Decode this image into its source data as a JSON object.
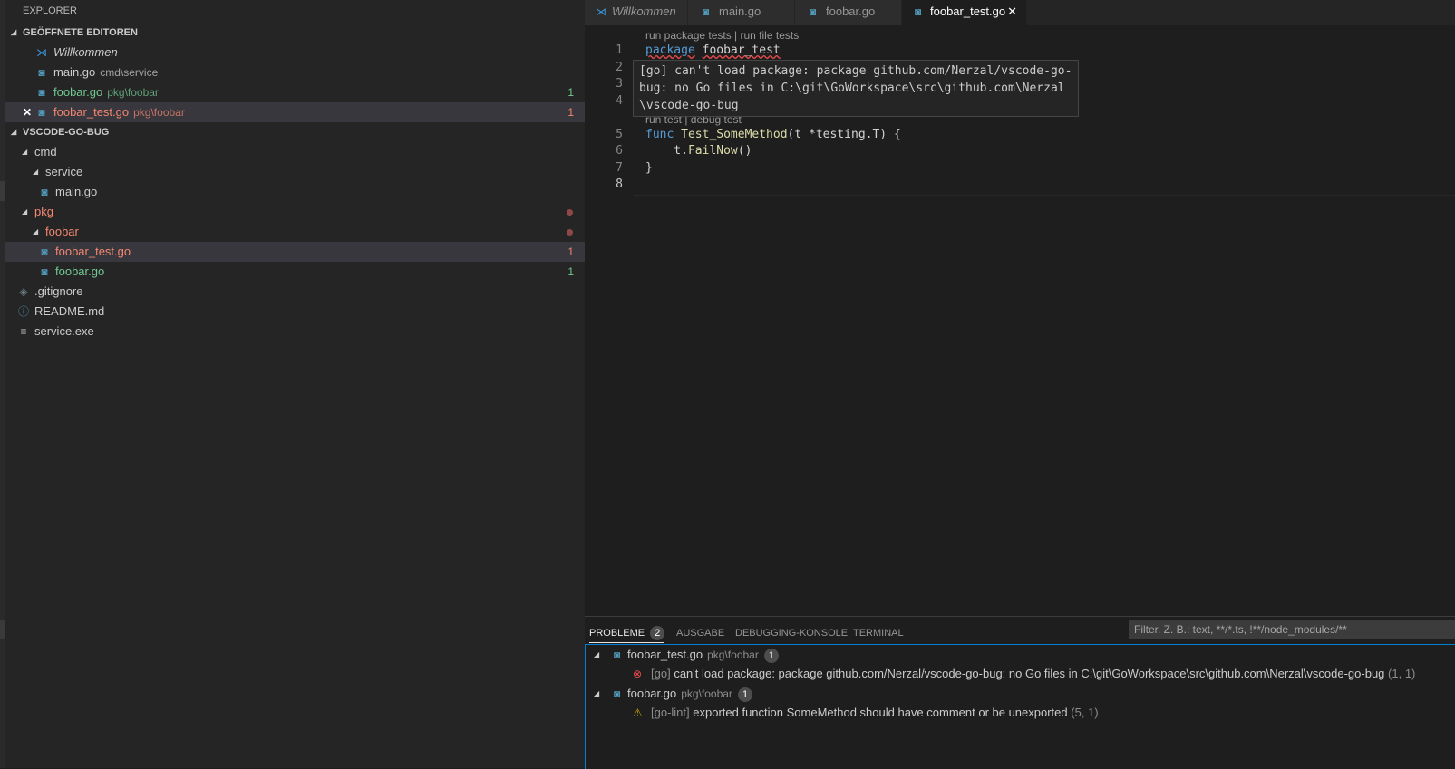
{
  "sidebar": {
    "title": "EXPLORER",
    "open_editors": {
      "header": "GEÖFFNETE EDITOREN",
      "items": [
        {
          "label": "Willkommen",
          "desc": "",
          "badge": ""
        },
        {
          "label": "main.go",
          "desc": "cmd\\service",
          "badge": ""
        },
        {
          "label": "foobar.go",
          "desc": "pkg\\foobar",
          "badge": "1"
        },
        {
          "label": "foobar_test.go",
          "desc": "pkg\\foobar",
          "badge": "1"
        }
      ]
    },
    "workspace": {
      "header": "VSCODE-GO-BUG",
      "items": [
        {
          "label": "cmd",
          "badge": ""
        },
        {
          "label": "service",
          "badge": ""
        },
        {
          "label": "main.go",
          "badge": ""
        },
        {
          "label": "pkg",
          "badge": ""
        },
        {
          "label": "foobar",
          "badge": ""
        },
        {
          "label": "foobar_test.go",
          "badge": "1"
        },
        {
          "label": "foobar.go",
          "badge": "1"
        },
        {
          "label": ".gitignore",
          "badge": ""
        },
        {
          "label": "README.md",
          "badge": ""
        },
        {
          "label": "service.exe",
          "badge": ""
        }
      ]
    }
  },
  "tabs": [
    {
      "label": "Willkommen"
    },
    {
      "label": "main.go"
    },
    {
      "label": "foobar.go"
    },
    {
      "label": "foobar_test.go"
    }
  ],
  "editor": {
    "codelens_top": "run package tests | run file tests",
    "codelens_func": "run test | debug test",
    "line_numbers": [
      "1",
      "2",
      "3",
      "4",
      "5",
      "6",
      "7",
      "8"
    ],
    "code": {
      "l1_kw": "package",
      "l1_name": "foobar_test",
      "l5_kw": "func",
      "l5_fn": "Test_SomeMethod",
      "l5_rest": "(t *testing.T) {",
      "l6_pre": "    t.",
      "l6_fn": "FailNow",
      "l6_rest": "()",
      "l7": "}"
    },
    "hover": "[go] can't load package: package github.com/Nerzal/vscode-go-bug: no Go files in C:\\git\\GoWorkspace\\src\\github.com\\Nerzal\\vscode-go-bug"
  },
  "panel": {
    "tabs": [
      {
        "label": "PROBLEME",
        "count": "2"
      },
      {
        "label": "AUSGABE"
      },
      {
        "label": "DEBUGGING-KONSOLE"
      },
      {
        "label": "TERMINAL"
      }
    ],
    "filter_placeholder": "Filter. Z. B.: text, **/*.ts, !**/node_modules/**",
    "problems": [
      {
        "file": "foobar_test.go",
        "path": "pkg\\foobar",
        "count": "1",
        "source": "[go]",
        "message": "can't load package: package github.com/Nerzal/vscode-go-bug: no Go files in C:\\git\\GoWorkspace\\src\\github.com\\Nerzal\\vscode-go-bug",
        "position": "(1, 1)",
        "severity": "error"
      },
      {
        "file": "foobar.go",
        "path": "pkg\\foobar",
        "count": "1",
        "source": "[go-lint]",
        "message": "exported function SomeMethod should have comment or be unexported",
        "position": "(5, 1)",
        "severity": "warning"
      }
    ]
  },
  "icons": {
    "go_file": "gopher-icon",
    "vscode": "vscode-logo-icon",
    "close": "close-icon",
    "twistie": "triangle-expanded-icon",
    "error": "error-icon",
    "warning": "warning-icon",
    "info": "info-icon",
    "git": "git-icon",
    "file": "file-lines-icon"
  },
  "colors": {
    "accent": "#007fd4",
    "added_green": "#73c991",
    "error_red": "#f48771"
  }
}
